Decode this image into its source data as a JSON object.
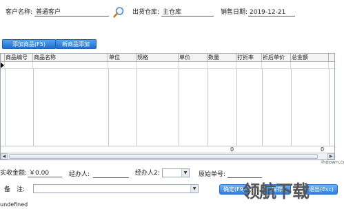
{
  "header": {
    "customer_label": "客户名称:",
    "customer_value": "普通客户",
    "warehouse_label": "出货仓库:",
    "warehouse_value": "主仓库",
    "date_label": "销售日期:",
    "date_value": "2019-12-21"
  },
  "toolbar": {
    "add_product_label": "添加商品(F5)",
    "new_product_label": "新商品添加"
  },
  "grid": {
    "columns": [
      "商品编号",
      "商品名称",
      "单位",
      "规格",
      "单价",
      "数量",
      "打折率",
      "折后单价",
      "总金额"
    ],
    "rows": [],
    "footer_total_qty": "0",
    "footer_total_amount": "0"
  },
  "bottom": {
    "received_label": "实收金额:",
    "received_value": "￥0.00",
    "handler_label": "经办人:",
    "handler2_label": "经办人2:",
    "original_no_label": "原始单号:",
    "remark_label": "备　注:",
    "confirm_label": "确定(F9)",
    "save_label": "保存",
    "exit_label": "退出(Esc)"
  },
  "status": {
    "text": "undefined"
  },
  "watermark": {
    "text": "领航下载",
    "url": "lhdown.com"
  }
}
